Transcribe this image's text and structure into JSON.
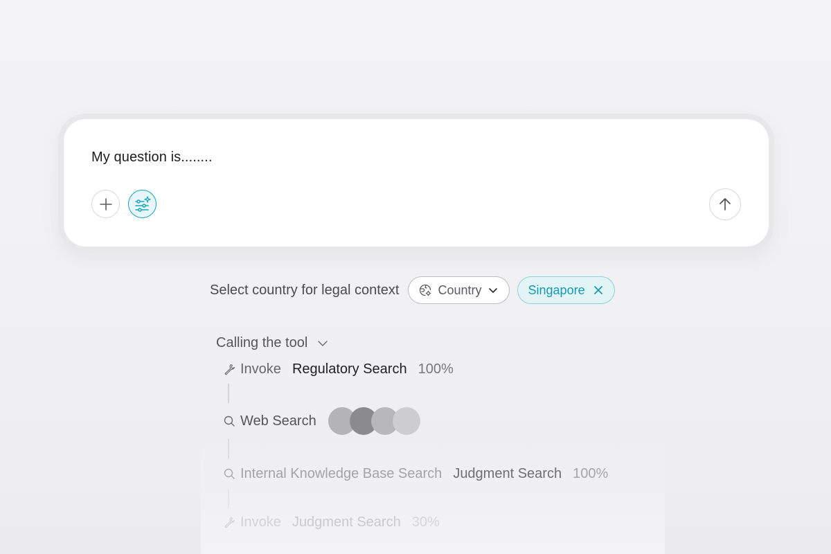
{
  "composer": {
    "question_text": "My question is........",
    "add_icon": "plus-icon",
    "tools_icon": "sliders-sparkle-icon",
    "send_icon": "arrow-up-icon",
    "accent_color": "#16a6c0"
  },
  "country_filter": {
    "label": "Select country for legal context",
    "select_placeholder": "Country",
    "select_icon": "globe-gear-icon",
    "chevron_icon": "chevron-down-icon",
    "selected_chip": "Singapore",
    "remove_icon": "close-icon",
    "chip_color": "#129ab3"
  },
  "tool_calls": {
    "header": "Calling the tool",
    "steps": [
      {
        "icon": "wrench-icon",
        "action": "Invoke",
        "target": "Regulatory Search",
        "progress": "100%"
      },
      {
        "icon": "search-icon",
        "action": "Web Search",
        "loading_dots": [
          "#b4b4b8",
          "#8b8b8f",
          "#b8b8bc",
          "#cdcdd0"
        ]
      },
      {
        "icon": "search-icon",
        "action": "Internal Knowledge Base Search",
        "target": "Judgment Search",
        "progress": "100%"
      },
      {
        "icon": "wrench-icon",
        "action": "Invoke",
        "target": "Judgment Search",
        "progress": "30%"
      }
    ]
  }
}
